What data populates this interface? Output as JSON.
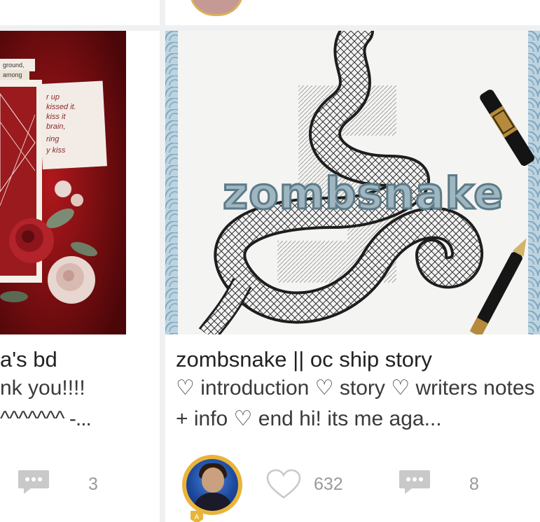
{
  "posts": [
    {
      "title": "a's bd",
      "excerpt_lines": [
        "nk you!!!!",
        "^^^^^^^ -..."
      ],
      "comments": "3"
    },
    {
      "title": "zombsnake || oc ship story",
      "excerpt": "♡ introduction ♡ story ♡ writers notes + info ♡ end hi! its me aga...",
      "cover_text": "zombsnake",
      "likes": "632",
      "comments": "8"
    }
  ],
  "left_cover_text": {
    "snippet1": "ground,",
    "snippet2": "among",
    "note_lines": [
      "r up",
      "kissed it.",
      "kiss it",
      "brain,",
      "ring",
      "y kiss"
    ]
  },
  "colors": {
    "accent_gold": "#e8b43a",
    "icon_gray": "#c9c9c9"
  }
}
